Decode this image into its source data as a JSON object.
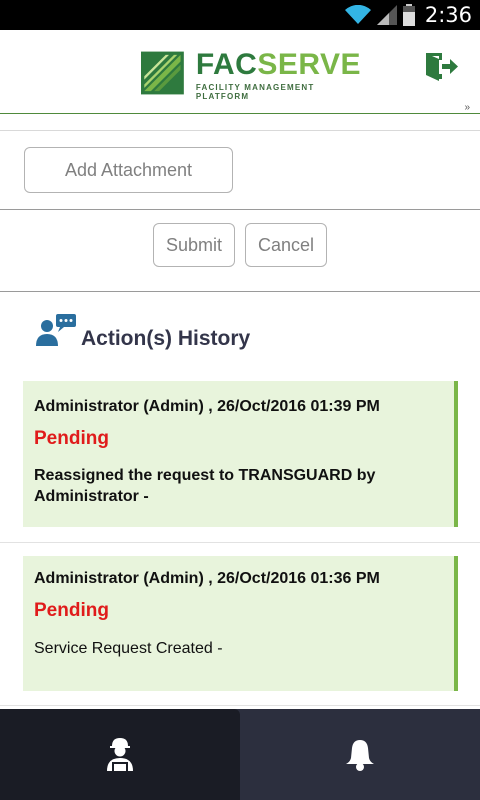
{
  "status_bar": {
    "time": "2:36"
  },
  "header": {
    "logo": {
      "part1": "FAC",
      "part2": "SERVE",
      "tagline": "FACILITY MANAGEMENT PLATFORM"
    },
    "corner_glyph": "»"
  },
  "form": {
    "add_attachment_label": "Add Attachment",
    "submit_label": "Submit",
    "cancel_label": "Cancel"
  },
  "history": {
    "title": "Action(s) History",
    "entries": [
      {
        "meta": "Administrator (Admin) , 26/Oct/2016 01:39 PM",
        "status": "Pending",
        "description_prefix": "Reassigned the request to ",
        "description_name": "TRANSGUARD",
        "description_suffix": " by",
        "description_line2": "Administrator -"
      },
      {
        "meta": "Administrator (Admin) , 26/Oct/2016 01:36 PM",
        "status": "Pending",
        "description": "Service Request Created -"
      }
    ]
  },
  "colors": {
    "brand_dark_green": "#2e7a3e",
    "brand_light_green": "#7ab648",
    "status_pending": "#e01b1b",
    "card_bg": "#e8f4dc",
    "nav_bg": "#2c2f3e"
  },
  "icons": {
    "wifi": "wifi-icon",
    "signal": "signal-icon",
    "battery": "battery-icon",
    "logout": "logout-icon",
    "history": "user-chat-icon",
    "nav_profile": "technician-icon",
    "nav_notifications": "bell-icon"
  }
}
